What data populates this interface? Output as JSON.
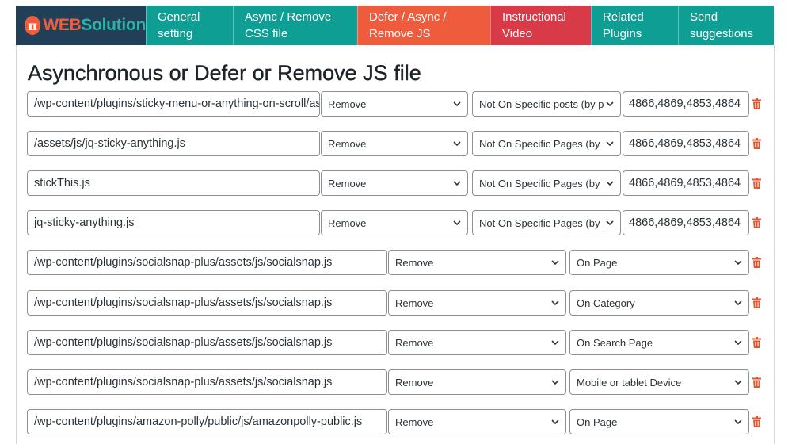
{
  "logo": {
    "mark": "π",
    "word_a": "WEB",
    "word_b": "Solution"
  },
  "tabs": [
    {
      "label": "General setting",
      "line1": "General",
      "line2": "setting"
    },
    {
      "label": "Async / Remove CSS file",
      "line1": "Async / Remove",
      "line2": "CSS file"
    },
    {
      "label": "Defer / Async / Remove JS",
      "line1": "Defer / Async /",
      "line2": "Remove JS"
    },
    {
      "label": "Instructional Video",
      "line1": "Instructional",
      "line2": "Video"
    },
    {
      "label": "Related Plugins",
      "line1": "Related",
      "line2": "Plugins"
    },
    {
      "label": "Send suggestions",
      "line1": "Send",
      "line2": "suggestions"
    }
  ],
  "active_tab": "Defer / Async / Remove JS",
  "page_title": "Asynchronous or Defer or Remove JS file",
  "rows": [
    {
      "path": "/wp-content/plugins/sticky-menu-or-anything-on-scroll/assets/js/jq-sticky-anything.min.js",
      "action": "Remove",
      "condition": "Not On Specific posts (by path)",
      "ids": "4866,4869,4853,4864"
    },
    {
      "path": "/assets/js/jq-sticky-anything.js",
      "action": "Remove",
      "condition": "Not On Specific Pages (by path)",
      "ids": "4866,4869,4853,4864"
    },
    {
      "path": "stickThis.js",
      "action": "Remove",
      "condition": "Not On Specific Pages (by path)",
      "ids": "4866,4869,4853,4864"
    },
    {
      "path": "jq-sticky-anything.js",
      "action": "Remove",
      "condition": "Not On Specific Pages (by path)",
      "ids": "4866,4869,4853,4864"
    },
    {
      "path": "/wp-content/plugins/socialsnap-plus/assets/js/socialsnap.js",
      "action": "Remove",
      "condition": "On Page"
    },
    {
      "path": "/wp-content/plugins/socialsnap-plus/assets/js/socialsnap.js",
      "action": "Remove",
      "condition": "On Category"
    },
    {
      "path": "/wp-content/plugins/socialsnap-plus/assets/js/socialsnap.js",
      "action": "Remove",
      "condition": "On Search Page"
    },
    {
      "path": "/wp-content/plugins/socialsnap-plus/assets/js/socialsnap.js",
      "action": "Remove",
      "condition": "Mobile or tablet Device"
    },
    {
      "path": "/wp-content/plugins/amazon-polly/public/js/amazonpolly-public.js",
      "action": "Remove",
      "condition": "On Page"
    }
  ],
  "icons": {
    "dropdown": "chevron-down-icon",
    "delete": "trash-icon"
  },
  "colors": {
    "teal": "#0e9e94",
    "orange": "#ee5b3d",
    "red": "#d93a48",
    "navy": "#213f57",
    "trash": "#e4572e"
  }
}
